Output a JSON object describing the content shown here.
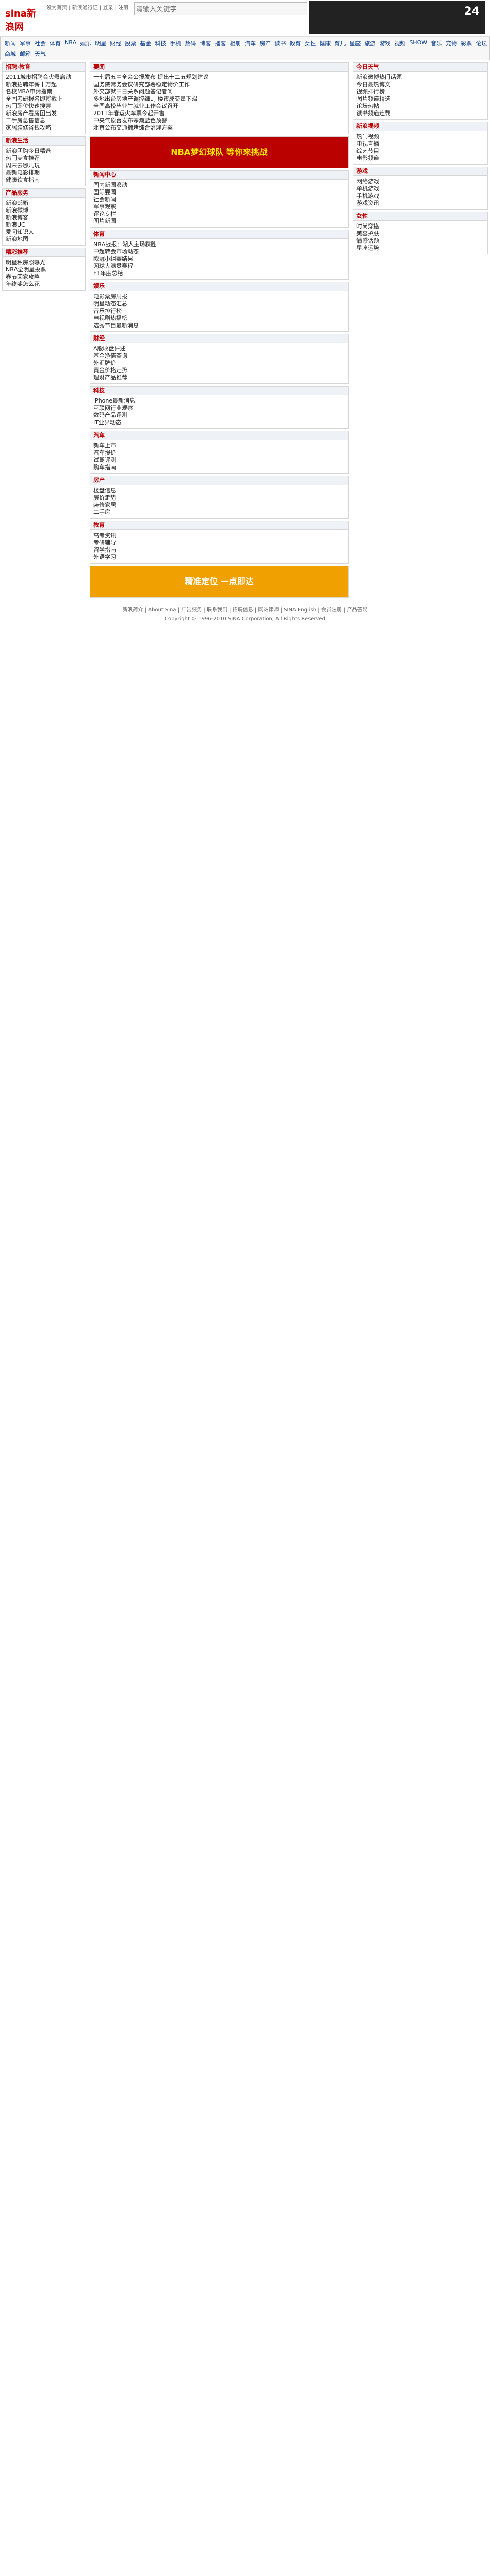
{
  "topbar": {
    "logo": "sina新浪网",
    "address": "http://www.sina.com.cn/",
    "nav": [
      "设为首页",
      "新浪通行证",
      "登录",
      "注册"
    ],
    "search": {
      "placeholder": "请输入关键字"
    }
  },
  "mainnav": {
    "items": [
      "新闻",
      "军事",
      "社会",
      "体育",
      "NBA",
      "娱乐",
      "明星",
      "财经",
      "股票",
      "基金",
      "科技",
      "手机",
      "数码",
      "博客",
      "播客",
      "相册",
      "汽车",
      "房产",
      "读书",
      "教育",
      "女性",
      "健康",
      "育儿",
      "星座",
      "旅游",
      "游戏",
      "视频",
      "SHOW",
      "音乐",
      "宠物",
      "彩票",
      "论坛",
      "商城",
      "邮箱",
      "天气"
    ]
  },
  "left": {
    "headlines": [
      "2011城市招聘会火爆启动",
      "新浪招聘年薪十万起",
      "名校MBA申请指南",
      "全国考研报名即将截止",
      "热门职位快速搜索",
      "新浪房产看房团出发",
      "二手房急售信息",
      "家居装修省钱攻略"
    ],
    "boxes": [
      {
        "title": "新浪生活",
        "items": [
          "新浪团购今日精选",
          "热门美食推荐",
          "周末去哪儿玩",
          "最新电影排期",
          "健康饮食指南"
        ]
      },
      {
        "title": "产品服务",
        "items": [
          "新浪邮箱",
          "新浪微博",
          "新浪博客",
          "新浪UC",
          "爱问知识人",
          "新浪地图"
        ]
      },
      {
        "title": "精彩推荐",
        "items": [
          "明星私房照曝光",
          "NBA全明星投票",
          "春节回家攻略",
          "年终奖怎么花"
        ]
      }
    ]
  },
  "center": {
    "top_news": [
      "十七届五中全会公报发布 提出十二五规划建议",
      "国务院常务会议研究部署稳定物价工作",
      "外交部就中日关系问题答记者问",
      "多地出台房地产调控细则 楼市成交量下滑",
      "全国高校毕业生就业工作会议召开",
      "2011年春运火车票今起开售",
      "中央气象台发布寒潮蓝色预警",
      "北京公布交通拥堵综合治理方案"
    ],
    "sections": [
      {
        "title": "新闻中心",
        "items": [
          "国内新闻滚动",
          "国际要闻",
          "社会新闻",
          "军事观察",
          "评论专栏",
          "图片新闻"
        ]
      },
      {
        "title": "体育",
        "items": [
          "NBA战报：湖人主场获胜",
          "中超转会市场动态",
          "欧冠小组赛结果",
          "网球大满贯赛程",
          "F1年度总结"
        ]
      },
      {
        "title": "娱乐",
        "items": [
          "电影票房周报",
          "明星动态汇总",
          "音乐排行榜",
          "电视剧热播榜",
          "选秀节目最新消息"
        ]
      },
      {
        "title": "财经",
        "items": [
          "A股收盘评述",
          "基金净值查询",
          "外汇牌价",
          "黄金价格走势",
          "理财产品推荐"
        ]
      },
      {
        "title": "科技",
        "items": [
          "iPhone最新消息",
          "互联网行业观察",
          "数码产品评测",
          "IT业界动态"
        ]
      },
      {
        "title": "汽车",
        "items": [
          "新车上市",
          "汽车报价",
          "试驾评测",
          "购车指南"
        ]
      },
      {
        "title": "房产",
        "items": [
          "楼盘信息",
          "房价走势",
          "装修家居",
          "二手房"
        ]
      },
      {
        "title": "教育",
        "items": [
          "高考资讯",
          "考研辅导",
          "留学指南",
          "外语学习"
        ]
      }
    ]
  },
  "right": {
    "weather": "今日天气",
    "hot": [
      "新浪微博热门话题",
      "今日最热博文",
      "视频排行榜",
      "图片频道精选",
      "论坛热帖",
      "读书频道连载"
    ],
    "boxes": [
      {
        "title": "新浪视频",
        "items": [
          "热门视频",
          "电视直播",
          "综艺节目",
          "电影频道"
        ]
      },
      {
        "title": "游戏",
        "items": [
          "网络游戏",
          "单机游戏",
          "手机游戏",
          "游戏资讯"
        ]
      },
      {
        "title": "女性",
        "items": [
          "时尚穿搭",
          "美容护肤",
          "情感话题",
          "星座运势"
        ]
      }
    ]
  },
  "promo": {
    "banner1": "NBA梦幻球队 等你来挑战",
    "banner2": "精准定位 一点即达"
  },
  "footer": {
    "links": [
      "新浪简介",
      "About Sina",
      "广告服务",
      "联系我们",
      "招聘信息",
      "网站律师",
      "SINA English",
      "会员注册",
      "产品答疑"
    ],
    "copyright": "Copyright © 1996-2010 SINA Corporation, All Rights Reserved"
  }
}
